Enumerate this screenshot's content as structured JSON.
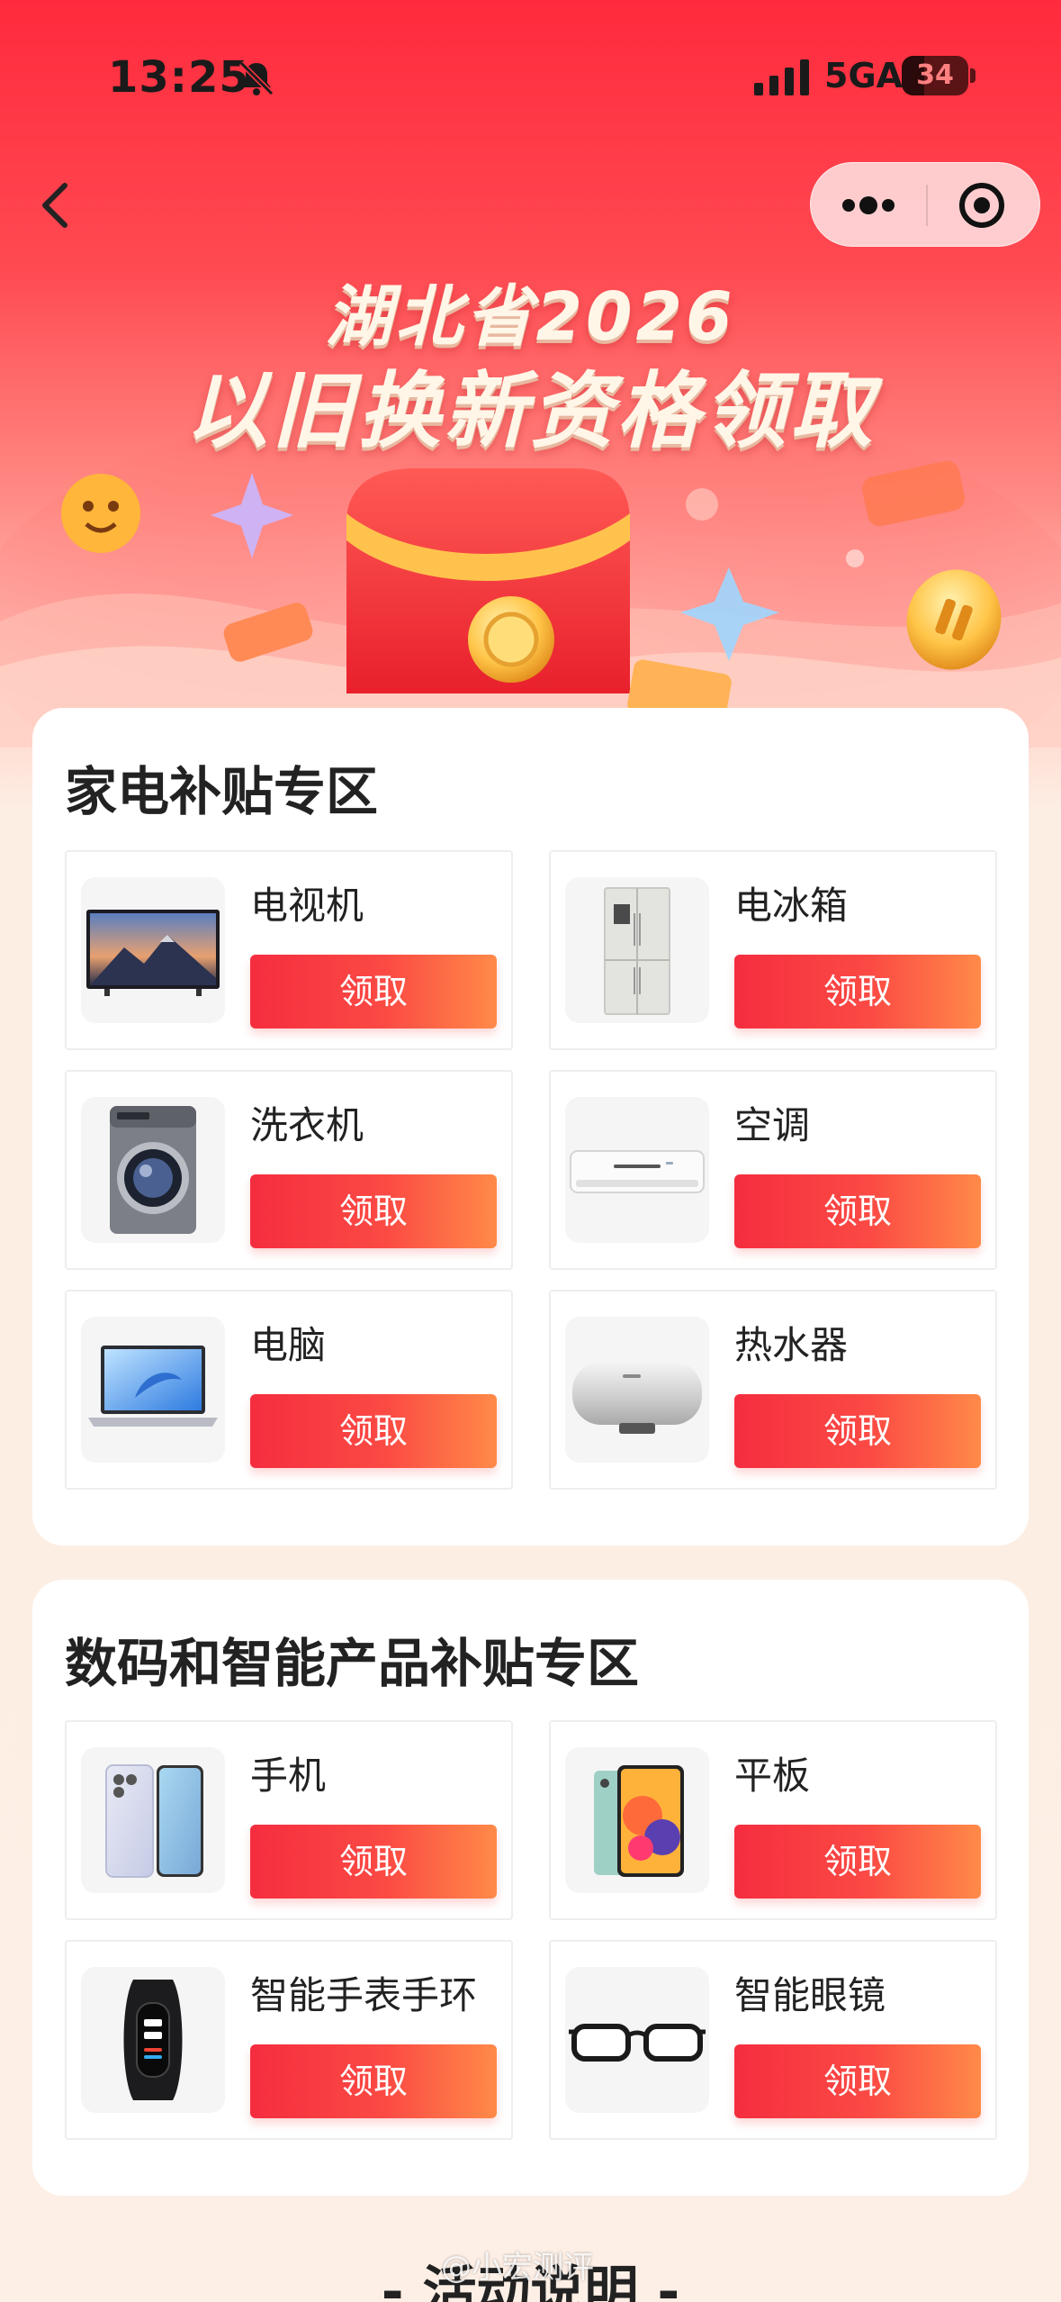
{
  "status_bar": {
    "time": "13:25",
    "network": "5GA",
    "battery_level": "34",
    "battery_fraction": 0.34,
    "bell_icon": "bell-slash-icon",
    "signal_icon": "cellular-signal-icon"
  },
  "nav": {
    "back_icon": "chevron-left-icon",
    "more_icon": "more-dots-icon",
    "close_icon": "target-circle-icon"
  },
  "banner": {
    "title_line1": "湖北省2026",
    "title_line2": "以旧换新资格领取"
  },
  "sections": [
    {
      "title": "家电补贴专区",
      "items": [
        {
          "name": "电视机",
          "button": "领取",
          "icon": "tv-icon"
        },
        {
          "name": "电冰箱",
          "button": "领取",
          "icon": "fridge-icon"
        },
        {
          "name": "洗衣机",
          "button": "领取",
          "icon": "washing-machine-icon"
        },
        {
          "name": "空调",
          "button": "领取",
          "icon": "air-conditioner-icon"
        },
        {
          "name": "电脑",
          "button": "领取",
          "icon": "laptop-icon"
        },
        {
          "name": "热水器",
          "button": "领取",
          "icon": "water-heater-icon"
        }
      ]
    },
    {
      "title": "数码和智能产品补贴专区",
      "items": [
        {
          "name": "手机",
          "button": "领取",
          "icon": "phone-icon"
        },
        {
          "name": "平板",
          "button": "领取",
          "icon": "tablet-icon"
        },
        {
          "name": "智能手表手环",
          "button": "领取",
          "icon": "smart-band-icon"
        },
        {
          "name": "智能眼镜",
          "button": "领取",
          "icon": "smart-glasses-icon"
        }
      ]
    }
  ],
  "footer": {
    "title": "- 活动说明 -",
    "watermark": "@小宏测评"
  },
  "colors": {
    "header_red": "#ff2a3d",
    "button_start": "#f52d3f",
    "button_end": "#ff8a48",
    "page_background": "#fdeee4"
  }
}
